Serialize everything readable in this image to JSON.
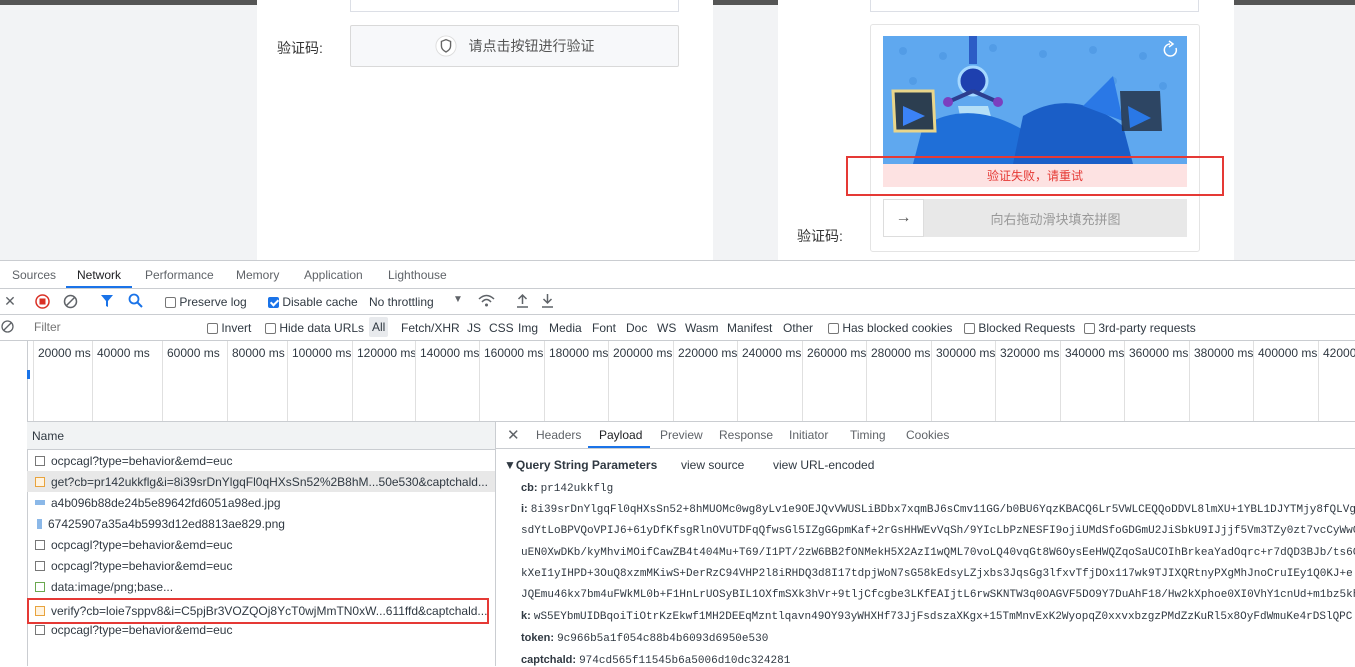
{
  "page": {
    "left_label": "验证码:",
    "verify_button": "请点击按钮进行验证",
    "right_label": "验证码:",
    "fail_message": "验证失败，请重试",
    "slider_hint": "向右拖动滑块填充拼图",
    "slider_arrow": "→"
  },
  "devtools": {
    "tabs": [
      "Sources",
      "Network",
      "Performance",
      "Memory",
      "Application",
      "Lighthouse"
    ],
    "active_tab": "Network",
    "toolbar": {
      "preserve_log": "Preserve log",
      "disable_cache": "Disable cache",
      "throttling": "No throttling"
    },
    "filter": {
      "placeholder": "Filter",
      "invert": "Invert",
      "hide_data_urls": "Hide data URLs",
      "types": [
        "All",
        "Fetch/XHR",
        "JS",
        "CSS",
        "Img",
        "Media",
        "Font",
        "Doc",
        "WS",
        "Wasm",
        "Manifest",
        "Other"
      ],
      "has_blocked_cookies": "Has blocked cookies",
      "blocked_requests": "Blocked Requests",
      "third_party": "3rd-party requests"
    },
    "timeline_ticks": [
      "20000 ms",
      "40000 ms",
      "60000 ms",
      "80000 ms",
      "100000 ms",
      "120000 ms",
      "140000 ms",
      "160000 ms",
      "180000 ms",
      "200000 ms",
      "220000 ms",
      "240000 ms",
      "260000 ms",
      "280000 ms",
      "300000 ms",
      "320000 ms",
      "340000 ms",
      "360000 ms",
      "380000 ms",
      "400000 ms",
      "42000"
    ],
    "name_header": "Name",
    "requests": [
      {
        "name": "ocpcagl?type=behavior&emd=euc",
        "icon": "doc"
      },
      {
        "name": "get?cb=pr142ukkflg&i=8i39srDnYlgqFl0qHXsSn52%2B8hM...50e530&captchald...",
        "icon": "xhr"
      },
      {
        "name": "a4b096b88de24b5e89642fd6051a98ed.jpg",
        "icon": "img"
      },
      {
        "name": "67425907a35a4b5993d12ed8813ae829.png",
        "icon": "img"
      },
      {
        "name": "ocpcagl?type=behavior&emd=euc",
        "icon": "doc"
      },
      {
        "name": "ocpcagl?type=behavior&emd=euc",
        "icon": "doc"
      },
      {
        "name": "data:image/png;base...",
        "icon": "png"
      },
      {
        "name": "verify?cb=loie7sppv8&i=C5pjBr3VOZQOj8YcT0wjMmTN0xW...611ffd&captchald...",
        "icon": "xhr"
      },
      {
        "name": "ocpcagl?type=behavior&emd=euc",
        "icon": "doc"
      }
    ],
    "detail_tabs": [
      "Headers",
      "Payload",
      "Preview",
      "Response",
      "Initiator",
      "Timing",
      "Cookies"
    ],
    "active_detail_tab": "Payload",
    "payload": {
      "section_title": "▼Query String Parameters",
      "view_source": "view source",
      "view_url_encoded": "view URL-encoded",
      "cb_key": "cb:",
      "cb_val": "pr142ukkflg",
      "i_key": "i:",
      "i_lines": [
        "8i39srDnYlgqFl0qHXsSn52+8hMUOMc0wg8yLv1e9OEJQvVWUSLiBDbx7xqmBJ6sCmv11GG/b0BU6YqzKBACQ6Lr5VWLCEQQoDDVL8lmXU+1YBL1DJYTMjy8fQLVg",
        "sdYtLoBPVQoVPIJ6+61yDfKfsgRlnOVUTDFqQfwsGl5IZgGGpmKaf+2rGsHHWEvVqSh/9YIcLbPzNESFI9ojiUMdSfoGDGmU2JiSbkU9IJjjf5Vm3TZy0zt7vcCyWwG",
        "uEN0XwDKb/kyMhviMOifCawZB4t404Mu+T69/I1PT/2zW6BB2fONMekH5X2AzI1wQML70voLQ40vqGt8W6OysEeHWQZqoSaUCOIhBrkeaYadOqrc+r7dQD3BJb/ts6C",
        "kXeI1yIHPD+3OuQ8xzmMKiwS+DerRzC94VHP2l8iRHDQ3d8I17tdpjWoN7sG58kEdsyLZjxbs3JqsGg3lfxvTfjDOx117wk9TJIXQRtnyPXgMhJnoCruIEy1Q0KJ+e",
        "JQEmu46kx7bm4uFWkML0b+F1HnLrUOSyBIL1OXfmSXk3hVr+9tljCfcgbe3LKfEAIjtL6rwSKNTW3q0OAGVF5DO9Y7DuAhF18/Hw2kXphoe0XI0VhY1cnUd+m1bz5kh"
      ],
      "k_key": "k:",
      "k_val": "wS5EYbmUIDBqoiTiOtrKzEkwf1MH2DEEqMzntlqavn49OY93yWHXHf73JjFsdszaXKgx+15TmMnvExK2WyopqZ0xxvxbzgzPMdZzKuRl5x8OyFdWmuKe4rDSlQPC",
      "token_key": "token:",
      "token_val": "9c966b5a1f054c88b4b6093d6950e530",
      "captchald_key": "captchald:",
      "captchald_val": "974cd565f11545b6a5006d10dc324281"
    }
  },
  "colors": {
    "accent": "#1a73e8",
    "error": "#e53935",
    "fail_bg": "#fde2e2",
    "captcha_bg": "#5fa8ef"
  }
}
